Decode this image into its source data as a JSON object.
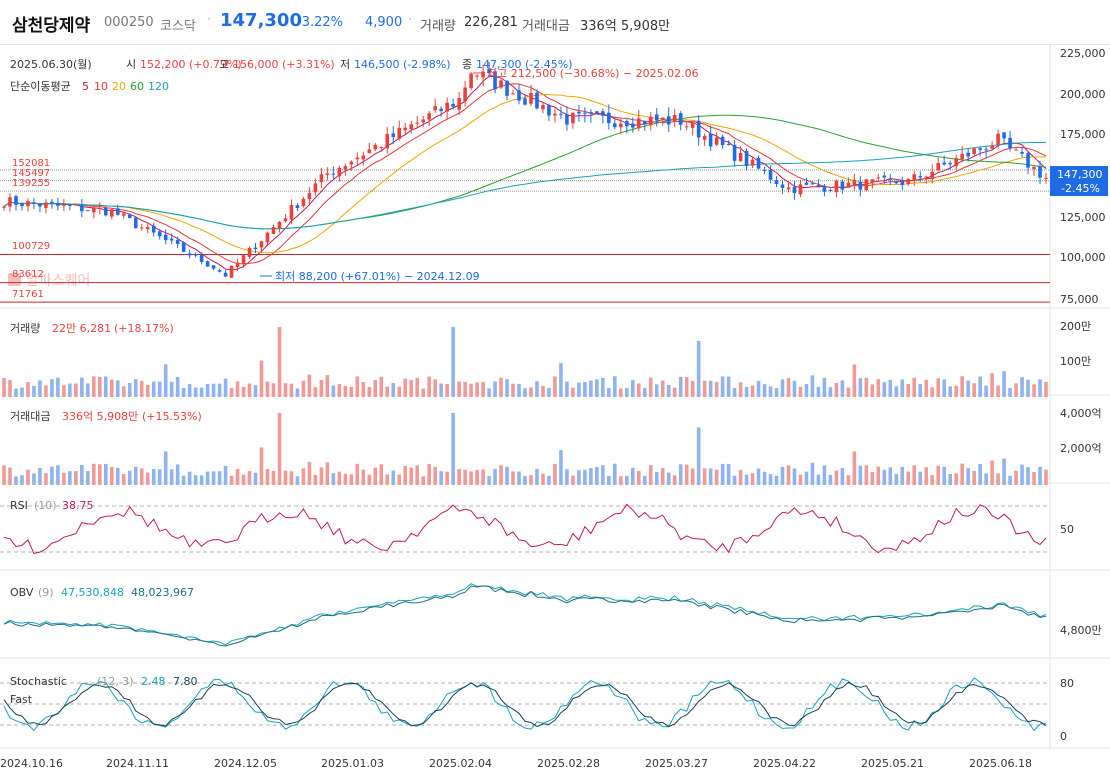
{
  "header": {
    "name": "삼천당제약",
    "code": "000250",
    "market": "코스닥",
    "price": "147,300",
    "change_pct": "-3.22%",
    "change": "4,900",
    "volume_label": "거래량",
    "volume": "226,281",
    "amount_label": "거래대금",
    "amount": "336억 5,908만"
  },
  "colors": {
    "up": "#e8413c",
    "down": "#1e6be6",
    "ma5": "#c2185b",
    "ma10": "#e53935",
    "ma20": "#f0a500",
    "ma60": "#2ca02c",
    "ma120": "#17a2b8"
  },
  "info": {
    "date": "2025.06.30(월)",
    "open_label": "시",
    "open": "152,200 (+0.79%)",
    "high_label": "고",
    "high": "156,000 (+3.31%)",
    "low_label": "저",
    "low": "146,500 (-2.98%)",
    "close_label": "종",
    "close": "147,300 (-2.45%)"
  },
  "ma_legend": {
    "label": "단순이동평균",
    "p5": "5",
    "p10": "10",
    "p20": "20",
    "p60": "60",
    "p120": "120"
  },
  "annotations": {
    "max": "최고 212,500 (−30.68%) − 2025.02.06",
    "min": "최저 88,200 (+67.01%) − 2024.12.09"
  },
  "watermark": "알파스퀘어",
  "price_axis": {
    "ticks": [
      "225,000",
      "200,000",
      "175,000",
      "150,000",
      "125,000",
      "100,000",
      "75,000"
    ],
    "current": "147,300",
    "current_pct": "-2.45%"
  },
  "levels": [
    "152081",
    "145497",
    "139255",
    "100729",
    "83612",
    "71761"
  ],
  "volume_panel": {
    "label": "거래량",
    "value": "22만 6,281",
    "change": "(+18.17%)",
    "ticks": [
      "200만",
      "100만"
    ]
  },
  "amount_panel": {
    "label": "거래대금",
    "value": "336억 5,908만",
    "change": "(+15.53%)",
    "ticks": [
      "4,000억",
      "2,000억"
    ]
  },
  "rsi_panel": {
    "label": "RSI",
    "param": "(10)",
    "value": "38.75",
    "ticks": [
      "50"
    ]
  },
  "obv_panel": {
    "label": "OBV",
    "param": "(9)",
    "value1": "47,530,848",
    "value2": "48,023,967",
    "ticks": [
      "4,800만"
    ]
  },
  "stoch_panel": {
    "label": "Stochastic",
    "label2": "Fast",
    "param": "(12, 3)",
    "value1": "2.48",
    "value2": "7.80",
    "ticks": [
      "80",
      "0"
    ]
  },
  "x_axis": [
    "2024.10.16",
    "2024.11.11",
    "2024.12.05",
    "2025.01.03",
    "2025.02.04",
    "2025.02.28",
    "2025.03.27",
    "2025.04.22",
    "2025.05.21",
    "2025.06.18"
  ],
  "chart_data": {
    "type": "candlestick",
    "ylim": [
      70000,
      225000
    ],
    "anchors": [
      {
        "date": "2024.10.16",
        "close": 133000
      },
      {
        "date": "2024.11.11",
        "close": 127000
      },
      {
        "date": "2024.12.05",
        "close": 93000
      },
      {
        "date": "2024.12.09",
        "close": 88200
      },
      {
        "date": "2025.01.03",
        "close": 150000
      },
      {
        "date": "2025.02.04",
        "close": 195000
      },
      {
        "date": "2025.02.06",
        "close": 212500
      },
      {
        "date": "2025.02.28",
        "close": 183000
      },
      {
        "date": "2025.03.27",
        "close": 182000
      },
      {
        "date": "2025.04.22",
        "close": 141000
      },
      {
        "date": "2025.05.21",
        "close": 145000
      },
      {
        "date": "2025.06.18",
        "close": 170000
      },
      {
        "date": "2025.06.30",
        "close": 147300
      }
    ],
    "last_candle": {
      "date": "2025.06.30",
      "open": 152200,
      "high": 156000,
      "low": 146500,
      "close": 147300,
      "volume": 226281
    }
  }
}
